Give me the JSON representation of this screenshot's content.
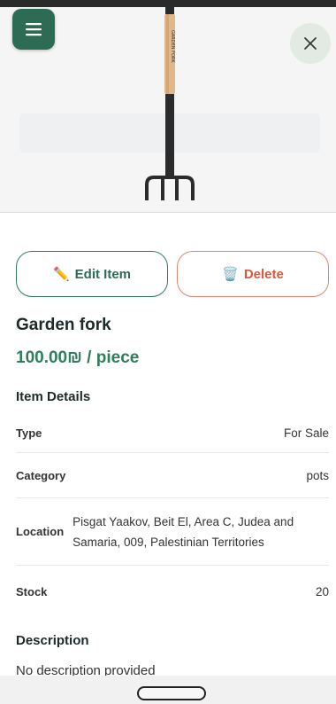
{
  "header": {
    "menu_icon": "hamburger-menu-icon",
    "close_icon": "close-icon"
  },
  "hero": {
    "image_subject": "garden-fork-image",
    "handle_text": "GARDEN FORK"
  },
  "actions": {
    "edit_label": "Edit Item",
    "edit_icon": "✏️",
    "delete_label": "Delete",
    "delete_icon": "🗑️"
  },
  "item": {
    "title": "Garden fork",
    "price": "100.00₪ / piece"
  },
  "details": {
    "heading": "Item Details",
    "rows": [
      {
        "label": "Type",
        "value": "For Sale"
      },
      {
        "label": "Category",
        "value": "pots"
      },
      {
        "label": "Location",
        "value": "Pisgat Yaakov, Beit El, Area C, Judea and Samaria, 009, Palestinian Territories"
      },
      {
        "label": "Stock",
        "value": "20"
      }
    ]
  },
  "description": {
    "heading": "Description",
    "text": "No description provided"
  },
  "colors": {
    "primary": "#2d6b54",
    "price": "#2e7d5b",
    "delete": "#d9573b"
  }
}
